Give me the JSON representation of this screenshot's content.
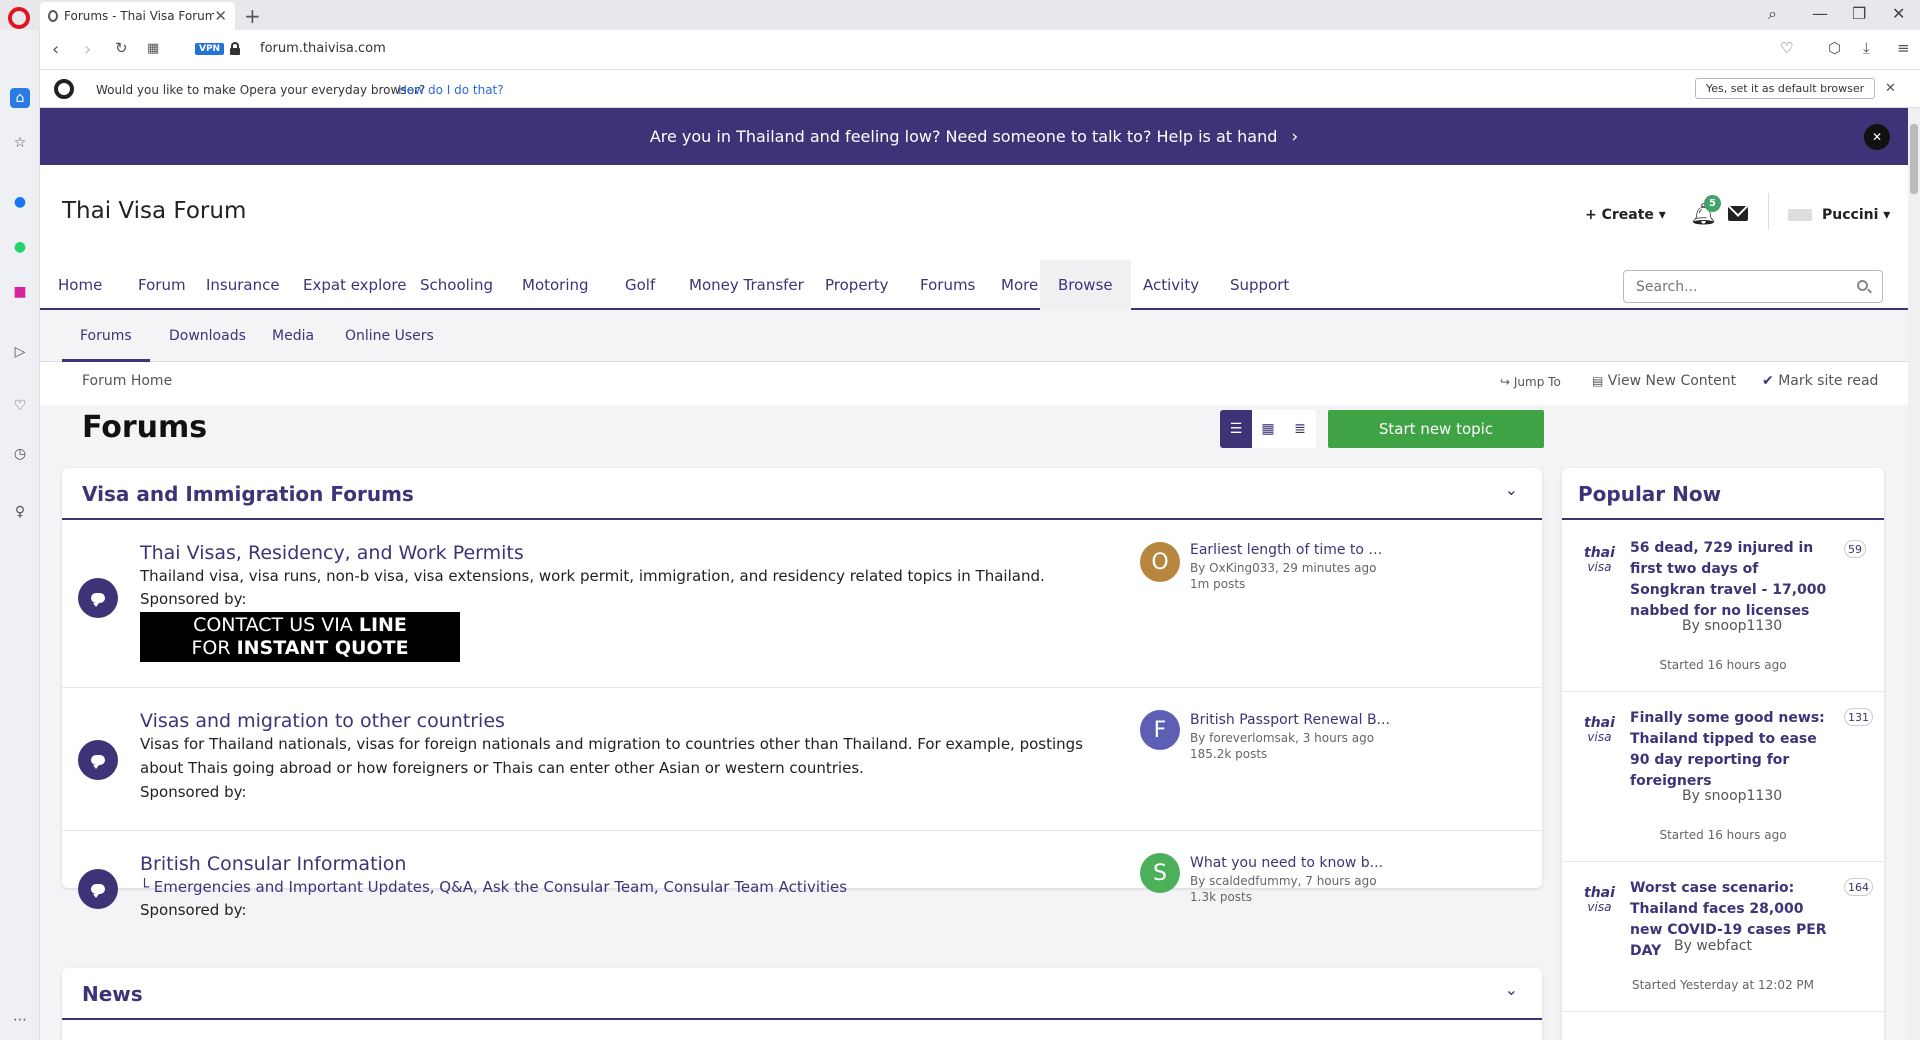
{
  "browser": {
    "tab_title": "Forums - Thai Visa Forum",
    "url": "forum.thaivisa.com",
    "vpn_label": "VPN",
    "infobar_text": "Would you like to make Opera your everyday browser?",
    "infobar_link": "How do I do that?",
    "infobar_button": "Yes, set it as default browser"
  },
  "banner": {
    "text": "Are you in Thailand and feeling low? Need someone to talk to? Help is at hand"
  },
  "header": {
    "site_title": "Thai Visa Forum",
    "create_label": "Create",
    "notification_count": "5",
    "username": "Puccini"
  },
  "main_nav": [
    "Home",
    "Forum",
    "Insurance",
    "Expat explore",
    "Schooling",
    "Motoring",
    "Golf",
    "Money Transfer",
    "Property",
    "Forums",
    "More",
    "Browse",
    "Activity",
    "Support"
  ],
  "search": {
    "placeholder": "Search..."
  },
  "sub_nav": [
    "Forums",
    "Downloads",
    "Media",
    "Online Users"
  ],
  "breadcrumb": "Forum Home",
  "crumb_actions": {
    "jump_to": "Jump To",
    "view_new": "View New Content",
    "mark_read": "Mark site read"
  },
  "page_title": "Forums",
  "start_topic": "Start new topic",
  "section1": {
    "title": "Visa and Immigration Forums",
    "rows": [
      {
        "title": "Thai Visas, Residency, and Work Permits",
        "desc": "Thailand visa, visa runs, non-b visa, visa extensions, work permit, immigration, and residency related topics in Thailand.",
        "sponsor": "Sponsored by:",
        "ad_line1_a": "CONTACT US VIA ",
        "ad_line1_b": "LINE",
        "ad_line2_a": "FOR ",
        "ad_line2_b": "INSTANT QUOTE",
        "last_initial": "O",
        "last_title": "Earliest length of time to a...",
        "last_by": "By OxKing033, 29 minutes ago",
        "last_posts": "1m  posts"
      },
      {
        "title": "Visas and migration to other countries",
        "desc": "Visas for Thailand nationals, visas for foreign nationals and migration to countries other than Thailand. For example, postings about Thais going abroad or how foreigners or Thais can enter other Asian or western countries.",
        "sponsor": "Sponsored by:",
        "last_initial": "F",
        "last_title": "British Passport Renewal B...",
        "last_by": "By foreverlomsak, 3 hours ago",
        "last_posts": "185.2k  posts"
      },
      {
        "title": "British Consular Information",
        "sublinks": "└  Emergencies and Important Updates,    Q&A, Ask the Consular Team,    Consular Team Activities",
        "sponsor": "Sponsored by:",
        "last_initial": "S",
        "last_title": "What you need to know b...",
        "last_by": "By scaldedfummy, 7 hours ago",
        "last_posts": "1.3k  posts"
      }
    ]
  },
  "section2": {
    "title": "News"
  },
  "popular": {
    "title": "Popular Now",
    "logo_top": "thai",
    "logo_bottom": "visa",
    "items": [
      {
        "title": "56 dead, 729 injured in first two days of Songkran travel - 17,000 nabbed for no licenses",
        "count": "59",
        "by": "By  snoop1130",
        "started": "Started 16 hours ago"
      },
      {
        "title": "Finally some good news: Thailand tipped to ease 90 day reporting for foreigners",
        "count": "131",
        "by": "By  snoop1130",
        "started": "Started 16 hours ago"
      },
      {
        "title": "Worst case scenario: Thailand faces 28,000 new COVID-19 cases PER DAY",
        "count": "164",
        "by": "By  webfact",
        "started": "Started Yesterday at 12:02 PM"
      }
    ]
  },
  "colors": {
    "brand": "#3d3478",
    "green": "#3fa346",
    "avatar_o": "#b8863f",
    "avatar_f": "#5d5fb5",
    "avatar_s": "#4cb05a"
  }
}
